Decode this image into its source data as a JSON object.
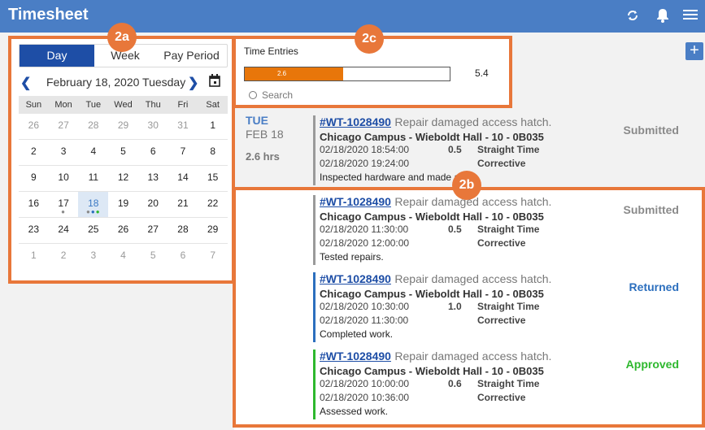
{
  "header": {
    "title": "Timesheet",
    "icons": [
      "sync-icon",
      "bell-icon",
      "menu-icon"
    ]
  },
  "calendar": {
    "views": [
      "Day",
      "Week",
      "Pay Period"
    ],
    "active_view": "Day",
    "month_label": "February 18, 2020 Tuesday",
    "weekdays": [
      "Sun",
      "Mon",
      "Tue",
      "Wed",
      "Thu",
      "Fri",
      "Sat"
    ],
    "weeks": [
      [
        "26",
        "27",
        "28",
        "29",
        "30",
        "31",
        "1"
      ],
      [
        "2",
        "3",
        "4",
        "5",
        "6",
        "7",
        "8"
      ],
      [
        "9",
        "10",
        "11",
        "12",
        "13",
        "14",
        "15"
      ],
      [
        "16",
        "17",
        "18",
        "19",
        "20",
        "21",
        "22"
      ],
      [
        "23",
        "24",
        "25",
        "26",
        "27",
        "28",
        "29"
      ],
      [
        "1",
        "2",
        "3",
        "4",
        "5",
        "6",
        "7"
      ]
    ],
    "selected_day": "18"
  },
  "time_entries": {
    "title": "Time Entries",
    "bar_value": "2.6",
    "bar_fraction": 0.48,
    "total": "5.4",
    "search_placeholder": "Search"
  },
  "day": {
    "weekday": "TUE",
    "date": "FEB 18",
    "hours": "2.6 hrs"
  },
  "entries": [
    {
      "wo": "#WT-1028490",
      "desc": "Repair damaged access hatch.",
      "status": "Submitted",
      "status_color": "#8a8a8a",
      "bar_color": "#9a9a9a",
      "location": "Chicago Campus - Wieboldt Hall - 10 - 0B035",
      "start": "02/18/2020 18:54:00",
      "end": "02/18/2020 19:24:00",
      "hours": "0.5",
      "type": "Straight Time",
      "category": "Corrective",
      "note": "Inspected hardware and made a list"
    },
    {
      "wo": "#WT-1028490",
      "desc": "Repair damaged access hatch.",
      "status": "Submitted",
      "status_color": "#8a8a8a",
      "bar_color": "#9a9a9a",
      "location": "Chicago Campus - Wieboldt Hall - 10 - 0B035",
      "start": "02/18/2020 11:30:00",
      "end": "02/18/2020 12:00:00",
      "hours": "0.5",
      "type": "Straight Time",
      "category": "Corrective",
      "note": "Tested repairs."
    },
    {
      "wo": "#WT-1028490",
      "desc": "Repair damaged access hatch.",
      "status": "Returned",
      "status_color": "#2c6fbe",
      "bar_color": "#2c6fbe",
      "location": "Chicago Campus - Wieboldt Hall - 10 - 0B035",
      "start": "02/18/2020 10:30:00",
      "end": "02/18/2020 11:30:00",
      "hours": "1.0",
      "type": "Straight Time",
      "category": "Corrective",
      "note": "Completed work."
    },
    {
      "wo": "#WT-1028490",
      "desc": "Repair damaged access hatch.",
      "status": "Approved",
      "status_color": "#2eb82e",
      "bar_color": "#2eb82e",
      "location": "Chicago Campus - Wieboldt Hall - 10 - 0B035",
      "start": "02/18/2020 10:00:00",
      "end": "02/18/2020 10:36:00",
      "hours": "0.6",
      "type": "Straight Time",
      "category": "Corrective",
      "note": "Assessed work."
    }
  ],
  "callouts": [
    "2a",
    "2b",
    "2c"
  ],
  "colors": {
    "header": "#4a7ec5",
    "active_tab": "#1e4ea6",
    "callout": "#e8773a",
    "bar_fill": "#e8760a"
  }
}
